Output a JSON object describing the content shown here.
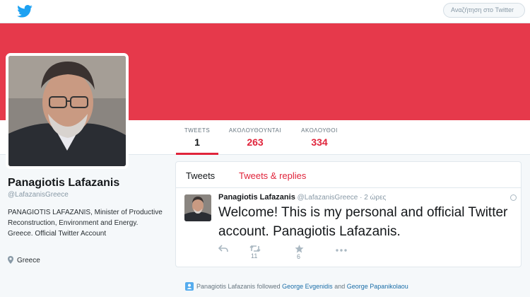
{
  "header": {
    "search_placeholder": "Αναζήτηση στο Twitter",
    "logo_icon": "twitter-bird-icon",
    "accent_color": "#1da1f2"
  },
  "banner": {
    "color": "#e6394b"
  },
  "stats": [
    {
      "label": "TWEETS",
      "value": "1"
    },
    {
      "label": "ΑΚΟΛΟΥΘΟΥΝΤΑΙ",
      "value": "263"
    },
    {
      "label": "ΑΚΟΛΟΥΘΟΙ",
      "value": "334"
    }
  ],
  "profile": {
    "name": "Panagiotis Lafazanis",
    "handle": "@LafazanisGreece",
    "bio": "PANAGIOTIS LAFAZANIS, Minister of Productive Reconstruction, Environment and Energy. Greece. Official Twitter Account",
    "location": "Greece"
  },
  "timeline": {
    "tabs": [
      "Tweets",
      "Tweets & replies"
    ],
    "tweet": {
      "name": "Panagiotis Lafazanis",
      "handle": "@LafazanisGreece",
      "separator": "·",
      "time": "2 ώρες",
      "text": "Welcome! This  is my personal and official Twitter account. Panagiotis Lafazanis.",
      "retweets": "11",
      "favorites": "6"
    }
  },
  "activity": {
    "actor": "Panagiotis Lafazanis",
    "verb": "followed",
    "user1": "George Evgenidis",
    "conj": "and",
    "user2": "George Papanikolaou"
  },
  "theme": {
    "link_red": "#e0243b",
    "link_blue": "#1b6ea8"
  }
}
